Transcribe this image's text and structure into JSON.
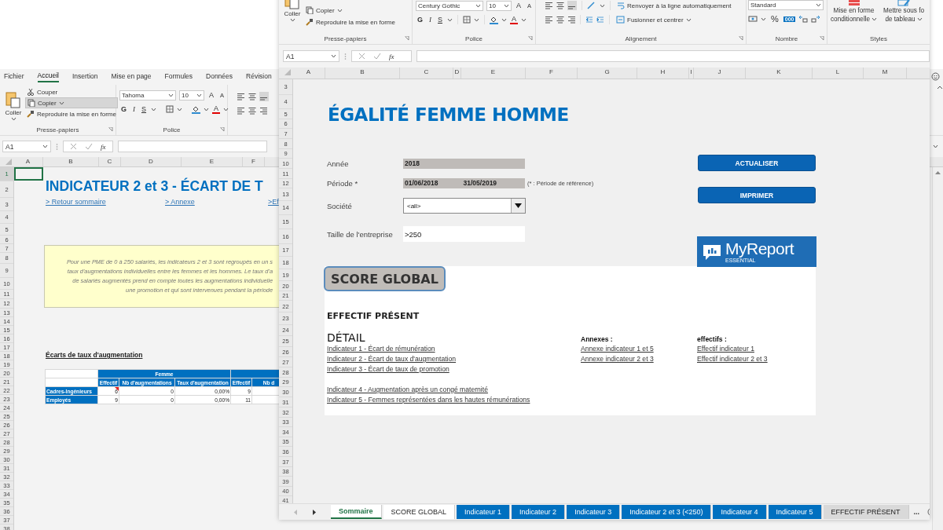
{
  "back_window": {
    "menu_tabs": [
      {
        "label": "Fichier",
        "selected": false
      },
      {
        "label": "Accueil",
        "selected": true
      },
      {
        "label": "Insertion",
        "selected": false
      },
      {
        "label": "Mise en page",
        "selected": false
      },
      {
        "label": "Formules",
        "selected": false
      },
      {
        "label": "Données",
        "selected": false
      },
      {
        "label": "Révision",
        "selected": false
      }
    ],
    "ribbon": {
      "clipboard": {
        "paste": "Coller",
        "cut": "Couper",
        "copy": "Copier",
        "copy_highlighted": true,
        "format_painter": "Reproduire la mise en forme",
        "label": "Presse-papiers"
      },
      "font": {
        "font_name": "Tahoma",
        "font_size": "10",
        "grow": "A",
        "shrink": "A",
        "bold": "G",
        "italic": "I",
        "underline": "S",
        "font_color": "A",
        "label": "Police"
      }
    },
    "name_box": "A1",
    "function_label": "fx",
    "columns": [
      "A",
      "B",
      "C",
      "D",
      "E",
      "F"
    ],
    "rows": [
      "1",
      "2",
      "3",
      "4",
      "5",
      "6",
      "7",
      "8",
      "9",
      "10",
      "11",
      "12",
      "13",
      "14",
      "15",
      "16",
      "17",
      "18",
      "19",
      "20",
      "21",
      "22",
      "23",
      "24",
      "25",
      "26",
      "27",
      "28",
      "29",
      "30",
      "31",
      "32",
      "33",
      "34",
      "35",
      "36",
      "37",
      "38"
    ],
    "sheet": {
      "title": "INDICATEUR 2 et 3 - ÉCART DE T",
      "links": [
        "> Retour sommaire",
        "> Annexe",
        ">Ef"
      ],
      "note_lines": [
        "Pour une PME de 0 à 250 salariés, les indicateurs 2 et 3 sont regroupés en un s",
        "taux d'augmentations individuelles entre les femmes et les hommes. Le taux d'a",
        "de salariés augmentés prend en compte toutes les augmentations individuelle",
        "une promotion et qui sont intervenues pendant la période"
      ],
      "table_title": "Écarts de taux d'augmentation",
      "table": {
        "group_header": "Femme",
        "columns": [
          "Effectif",
          "Nb d'augmentations",
          "Taux d'augmentation",
          "Effectif",
          "Nb d"
        ],
        "rows": [
          {
            "label": "Cadres-Ingénieurs",
            "cells": [
              "6",
              "0",
              "0,00%",
              "9"
            ],
            "comment": true
          },
          {
            "label": "Employés",
            "cells": [
              "9",
              "0",
              "0,00%",
              "11"
            ],
            "comment": false
          }
        ]
      }
    }
  },
  "front_window": {
    "ribbon": {
      "clipboard": {
        "paste": "Coller",
        "copy": "Copier",
        "format_painter": "Reproduire la mise en forme",
        "label": "Presse-papiers"
      },
      "font": {
        "font_name": "Century Gothic",
        "font_size": "10",
        "grow": "A",
        "shrink": "A",
        "bold": "G",
        "italic": "I",
        "underline": "S",
        "font_color": "A",
        "label": "Police"
      },
      "alignment": {
        "wrap": "Renvoyer à la ligne automatiquement",
        "merge": "Fusionner et centrer",
        "label": "Alignement"
      },
      "number": {
        "format": "Standard",
        "percent": "%",
        "thousands": "000",
        "label": "Nombre"
      },
      "styles": {
        "conditional": [
          "Mise en forme",
          "conditionnelle"
        ],
        "table": [
          "Mettre sous fo",
          "de tableau"
        ],
        "label": "Styles"
      }
    },
    "name_box": "A1",
    "function_label": "fx",
    "columns": [
      "A",
      "B",
      "C",
      "D",
      "E",
      "F",
      "G",
      "H",
      "I",
      "J",
      "K",
      "L",
      "M"
    ],
    "rows": [
      "3",
      "4",
      "5",
      "6",
      "7",
      "8",
      "9",
      "10",
      "11",
      "12",
      "13",
      "14",
      "15",
      "16",
      "17",
      "18",
      "19",
      "20",
      "21",
      "22",
      "23",
      "24",
      "25",
      "26",
      "27",
      "28",
      "29",
      "30",
      "31",
      "32",
      "33",
      "34",
      "35",
      "36",
      "37",
      "38",
      "39",
      "40",
      "41"
    ],
    "sheet": {
      "title": "ÉGALITÉ FEMME HOMME",
      "fields": [
        {
          "kind": "readonly",
          "label": "Année",
          "values": [
            "2018"
          ]
        },
        {
          "kind": "readonly",
          "label": "Période *",
          "values": [
            "01/06/2018",
            "31/05/2019"
          ],
          "note": "(* : Période de référence)"
        },
        {
          "kind": "dropdown",
          "label": "Société",
          "values": [
            "<all>"
          ]
        },
        {
          "kind": "input",
          "label": "Taille de l'entreprise",
          "values": [
            ">250"
          ]
        }
      ],
      "buttons": [
        "ACTUALISER",
        "IMPRIMER"
      ],
      "logo": {
        "name": "MyReport",
        "tagline": "ESSENTIAL"
      },
      "score_button": "SCORE GLOBAL",
      "section_title": "EFFECTIF PRÉSENT",
      "detail": {
        "title": "DÉTAIL",
        "link_groups": [
          [
            "Indicateur 1 - Écart de rémunération",
            "Indicateur 2 - Écart de taux d'augmentation",
            "Indicateur 3 - Écart de taux de promotion"
          ],
          [
            "Indicateur 4 - Augmentation après un congé maternité",
            "Indicateur 5 - Femmes représentées dans les hautes rémunérations"
          ]
        ]
      },
      "annexes": {
        "title": "Annexes :",
        "links": [
          "Annexe indicateur 1 et 5",
          "Annexe indicateur 2 et 3"
        ]
      },
      "effectifs": {
        "title": "effectifs :",
        "links": [
          "Effectif indicateur 1",
          "Effectif indicateur 2 et 3"
        ]
      }
    },
    "sheet_tabs": [
      {
        "label": "Sommaire",
        "selected": true,
        "color": "#ffffff"
      },
      {
        "label": "SCORE GLOBAL",
        "selected": false,
        "color": "#ffffff"
      },
      {
        "label": "Indicateur 1",
        "selected": false,
        "color": "#0070c0"
      },
      {
        "label": "Indicateur 2",
        "selected": false,
        "color": "#0070c0"
      },
      {
        "label": "Indicateur 3",
        "selected": false,
        "color": "#0070c0"
      },
      {
        "label": "Indicateur 2 et 3 (<250)",
        "selected": false,
        "color": "#0070c0"
      },
      {
        "label": "Indicateur 4",
        "selected": false,
        "color": "#0070c0"
      },
      {
        "label": "Indicateur 5",
        "selected": false,
        "color": "#0070c0"
      },
      {
        "label": "EFFECTIF PRÉSENT",
        "selected": false,
        "color": "#d9d9d9"
      }
    ],
    "more_tabs": "..."
  }
}
